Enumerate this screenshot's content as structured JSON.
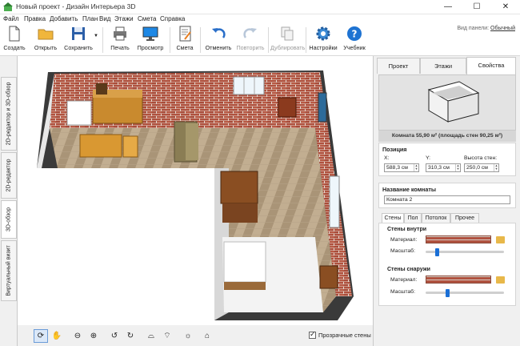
{
  "window": {
    "title": "Новый проект - Дизайн Интерьера 3D",
    "buttons": {
      "minimize": "—",
      "maximize": "☐",
      "close": "✕"
    }
  },
  "menu": [
    "Файл",
    "Правка",
    "Добавить",
    "План",
    "Вид",
    "Этажи",
    "Смета",
    "Справка"
  ],
  "toolbar": {
    "items": [
      {
        "label": "Создать",
        "icon": "new-file-icon",
        "enabled": true
      },
      {
        "label": "Открыть",
        "icon": "open-folder-icon",
        "enabled": true
      },
      {
        "label": "Сохранить",
        "icon": "save-icon",
        "enabled": true
      },
      {
        "label": "Печать",
        "icon": "printer-icon",
        "enabled": true
      },
      {
        "label": "Просмотр",
        "icon": "monitor-icon",
        "enabled": true
      },
      {
        "label": "Смета",
        "icon": "estimate-icon",
        "enabled": true
      },
      {
        "label": "Отменить",
        "icon": "undo-icon",
        "enabled": true
      },
      {
        "label": "Повторить",
        "icon": "redo-icon",
        "enabled": false
      },
      {
        "label": "Дублировать",
        "icon": "duplicate-icon",
        "enabled": false
      },
      {
        "label": "Настройки",
        "icon": "gear-icon",
        "enabled": true
      },
      {
        "label": "Учебник",
        "icon": "help-icon",
        "enabled": true
      }
    ],
    "panel_view_label": "Вид панели:",
    "panel_view_value": "Обычный"
  },
  "left_tabs": [
    "2D-редактор и 3D-обзор",
    "2D-редактор",
    "3D-обзор",
    "Виртуальный визит"
  ],
  "left_tab_active": "3D-обзор",
  "right_panel": {
    "tabs": [
      "Проект",
      "Этажи",
      "Свойства"
    ],
    "active_tab": "Свойства",
    "room_caption": "Комната 55,90 м²  (площадь стен 90,25 м²)",
    "position": {
      "title": "Позиция",
      "x_label": "X:",
      "x_value": "588,3 см",
      "y_label": "Y:",
      "y_value": "310,3 см",
      "height_label": "Высота стен:",
      "height_value": "250,0 см"
    },
    "room_name": {
      "title": "Название комнаты",
      "value": "Комната 2"
    },
    "sub_tabs": [
      "Стены",
      "Пол",
      "Потолок",
      "Прочее"
    ],
    "sub_tab_active": "Стены",
    "walls_inside": {
      "title": "Стены внутри",
      "material_label": "Материал:",
      "scale_label": "Масштаб:",
      "scale": 0.12
    },
    "walls_outside": {
      "title": "Стены снаружи",
      "material_label": "Материал:",
      "scale_label": "Масштаб:",
      "scale": 0.25
    }
  },
  "bottom_toolbar": {
    "buttons": [
      "360-view-icon",
      "hand-pan-icon",
      "zoom-out-icon",
      "zoom-in-icon",
      "rotate-left-icon",
      "rotate-right-icon",
      "tilt-up-icon",
      "tilt-down-icon",
      "light-bulb-icon",
      "home-icon"
    ],
    "active": "360-view-icon",
    "transparent_walls_label": "Прозрачные стены",
    "transparent_walls_checked": true
  },
  "colors": {
    "brick": "#b0523f",
    "floor": "#b7a387",
    "accent": "#1a6fd6",
    "wood": "#c98a2e"
  }
}
